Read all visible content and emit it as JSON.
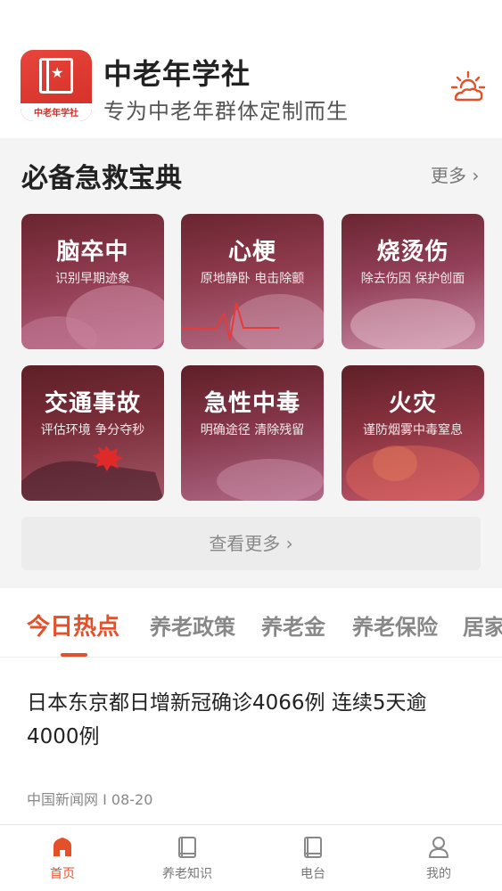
{
  "header": {
    "logo_text": "中老年学社",
    "app_title": "中老年学社",
    "app_subtitle": "专为中老年群体定制而生",
    "weather_icon": "sun-cloud-icon"
  },
  "first_aid": {
    "title": "必备急救宝典",
    "more_label": "更多 ›",
    "cards": [
      {
        "title": "脑卒中",
        "subtitle": "识别早期迹象"
      },
      {
        "title": "心梗",
        "subtitle": "原地静卧 电击除颤"
      },
      {
        "title": "烧烫伤",
        "subtitle": "除去伤因 保护创面"
      },
      {
        "title": "交通事故",
        "subtitle": "评估环境 争分夺秒"
      },
      {
        "title": "急性中毒",
        "subtitle": "明确途径 清除残留"
      },
      {
        "title": "火灾",
        "subtitle": "谨防烟雾中毒窒息"
      }
    ],
    "view_more_label": "查看更多 ›"
  },
  "tabs": [
    {
      "label": "今日热点",
      "active": true
    },
    {
      "label": "养老政策",
      "active": false
    },
    {
      "label": "养老金",
      "active": false
    },
    {
      "label": "养老保险",
      "active": false
    },
    {
      "label": "居家",
      "active": false
    }
  ],
  "news": [
    {
      "title": "日本东京都日增新冠确诊4066例 连续5天逾4000例",
      "meta": "中国新闻网 I 08-20"
    }
  ],
  "bottom_nav": [
    {
      "label": "首页",
      "icon": "home-icon",
      "active": true
    },
    {
      "label": "养老知识",
      "icon": "book-icon",
      "active": false
    },
    {
      "label": "电台",
      "icon": "book-icon",
      "active": false
    },
    {
      "label": "我的",
      "icon": "user-icon",
      "active": false
    }
  ],
  "colors": {
    "accent": "#e4502a",
    "card_dark": "#5e1f27",
    "card_light": "#c9607a"
  }
}
